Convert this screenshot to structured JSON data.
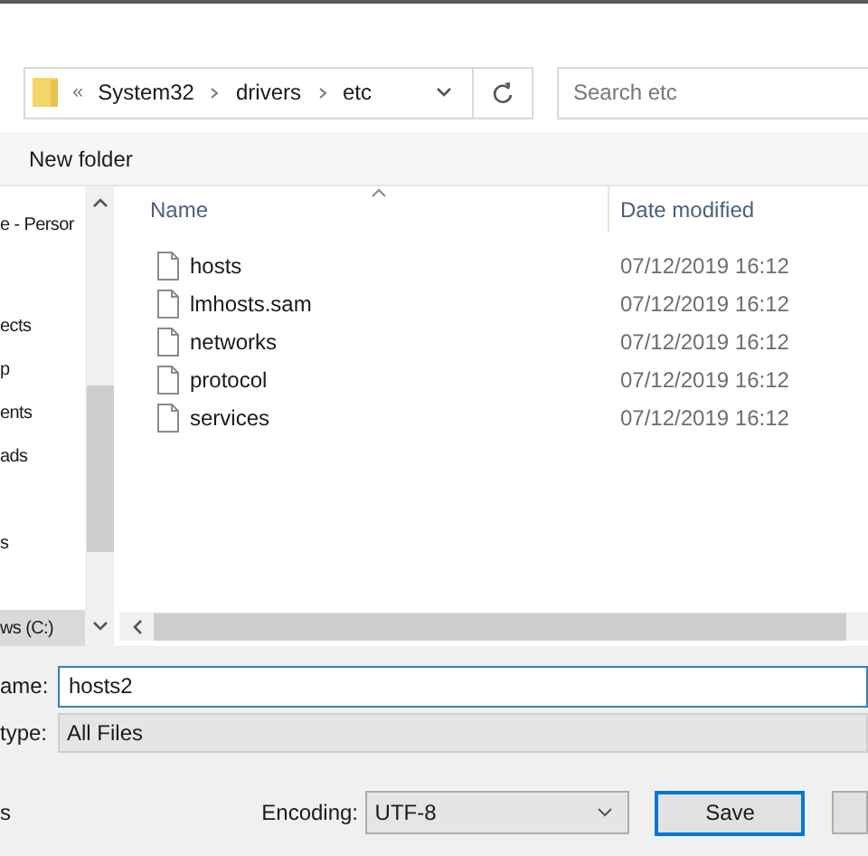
{
  "address_bar": {
    "overflow_chevron": "«",
    "breadcrumbs": [
      "System32",
      "drivers",
      "etc"
    ]
  },
  "search": {
    "placeholder": "Search etc"
  },
  "toolbar": {
    "buttons": [
      "New folder"
    ]
  },
  "nav_pane": {
    "items": [
      {
        "label": "e - Persor",
        "selected": false
      },
      {
        "label": "ects",
        "selected": false
      },
      {
        "label": "p",
        "selected": false
      },
      {
        "label": "ents",
        "selected": false
      },
      {
        "label": "ads",
        "selected": false
      },
      {
        "label": "s",
        "selected": false
      },
      {
        "label": "ws (C:)",
        "selected": true
      }
    ]
  },
  "file_list": {
    "columns": [
      "Name",
      "Date modified"
    ],
    "rows": [
      {
        "name": "hosts",
        "date": "07/12/2019 16:12"
      },
      {
        "name": "lmhosts.sam",
        "date": "07/12/2019 16:12"
      },
      {
        "name": "networks",
        "date": "07/12/2019 16:12"
      },
      {
        "name": "protocol",
        "date": "07/12/2019 16:12"
      },
      {
        "name": "services",
        "date": "07/12/2019 16:12"
      }
    ]
  },
  "file_name": {
    "label": "ame:",
    "value": "hosts2"
  },
  "save_as_type": {
    "label": "type:",
    "value": "All Files"
  },
  "hide_folders": {
    "label": "s"
  },
  "encoding": {
    "label": "Encoding:",
    "value": "UTF-8"
  },
  "buttons": [
    "Save"
  ]
}
